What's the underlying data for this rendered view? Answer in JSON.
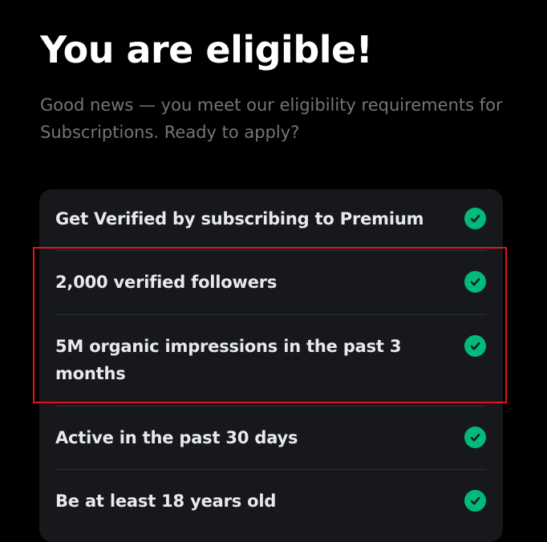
{
  "header": {
    "title": "You are eligible!",
    "subtitle": "Good news — you meet our eligibility requirements for Subscriptions. Ready to apply?"
  },
  "requirements": [
    {
      "label": "Get Verified by subscribing to Premium",
      "status": "met",
      "icon": "check-circle-icon"
    },
    {
      "label": "2,000 verified followers",
      "status": "met",
      "icon": "check-circle-icon"
    },
    {
      "label": "5M organic impressions in the past 3 months",
      "status": "met",
      "icon": "check-circle-icon"
    },
    {
      "label": "Active in the past 30 days",
      "status": "met",
      "icon": "check-circle-icon"
    },
    {
      "label": "Be at least 18 years old",
      "status": "met",
      "icon": "check-circle-icon"
    }
  ],
  "colors": {
    "background": "#000000",
    "card": "#16181c",
    "text_primary": "#e7e9ea",
    "text_secondary": "#71767b",
    "check": "#00ba7c",
    "highlight_annotation": "#e0161c"
  }
}
